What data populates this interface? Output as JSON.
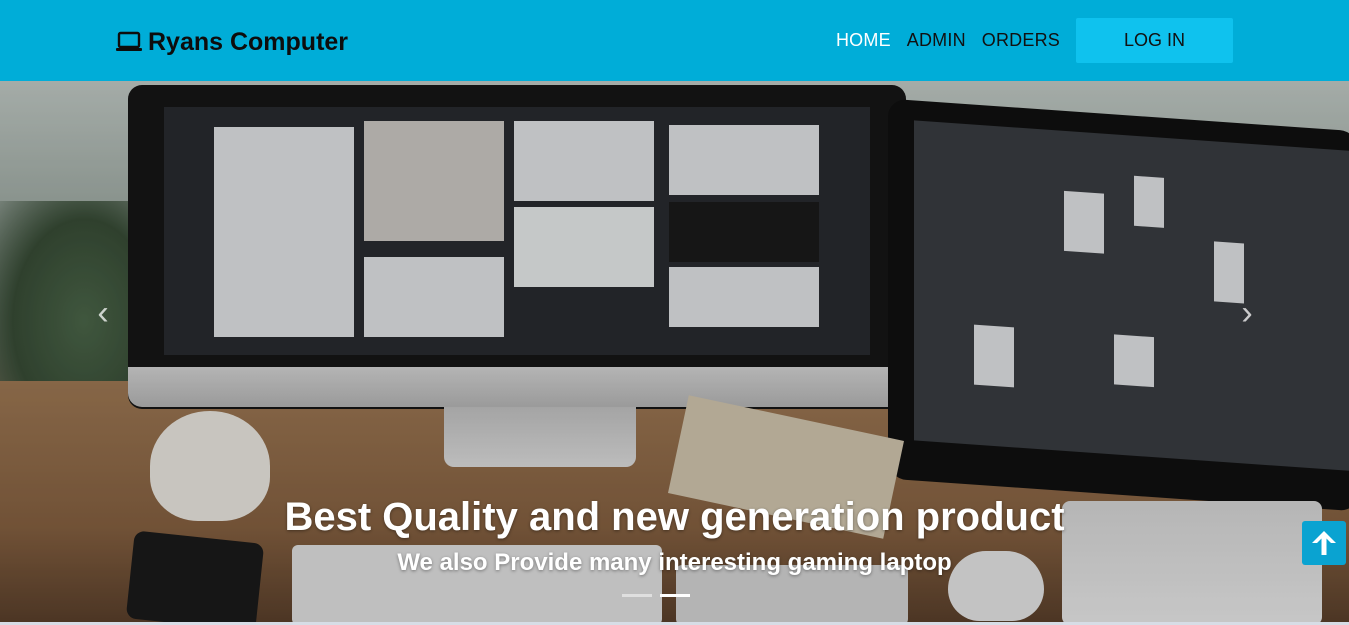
{
  "brand": {
    "name": "Ryans Computer",
    "icon": "laptop-icon"
  },
  "nav": {
    "items": [
      {
        "label": "HOME",
        "active": true
      },
      {
        "label": "ADMIN",
        "active": false
      },
      {
        "label": "ORDERS",
        "active": false
      }
    ],
    "login_label": "LOG IN"
  },
  "hero": {
    "title": "Best Quality and new generation product",
    "subtitle": "We also Provide many interesting gaming laptop",
    "prev_icon": "chevron-left-icon",
    "next_icon": "chevron-right-icon",
    "slides_count": 2,
    "active_slide": 2
  },
  "scroll_top": {
    "icon": "arrow-up-icon"
  },
  "colors": {
    "navbar": "#00add8",
    "login_button": "#0fc2ee",
    "scroll_top": "#0aa3d1",
    "active_link": "#ffffff"
  }
}
